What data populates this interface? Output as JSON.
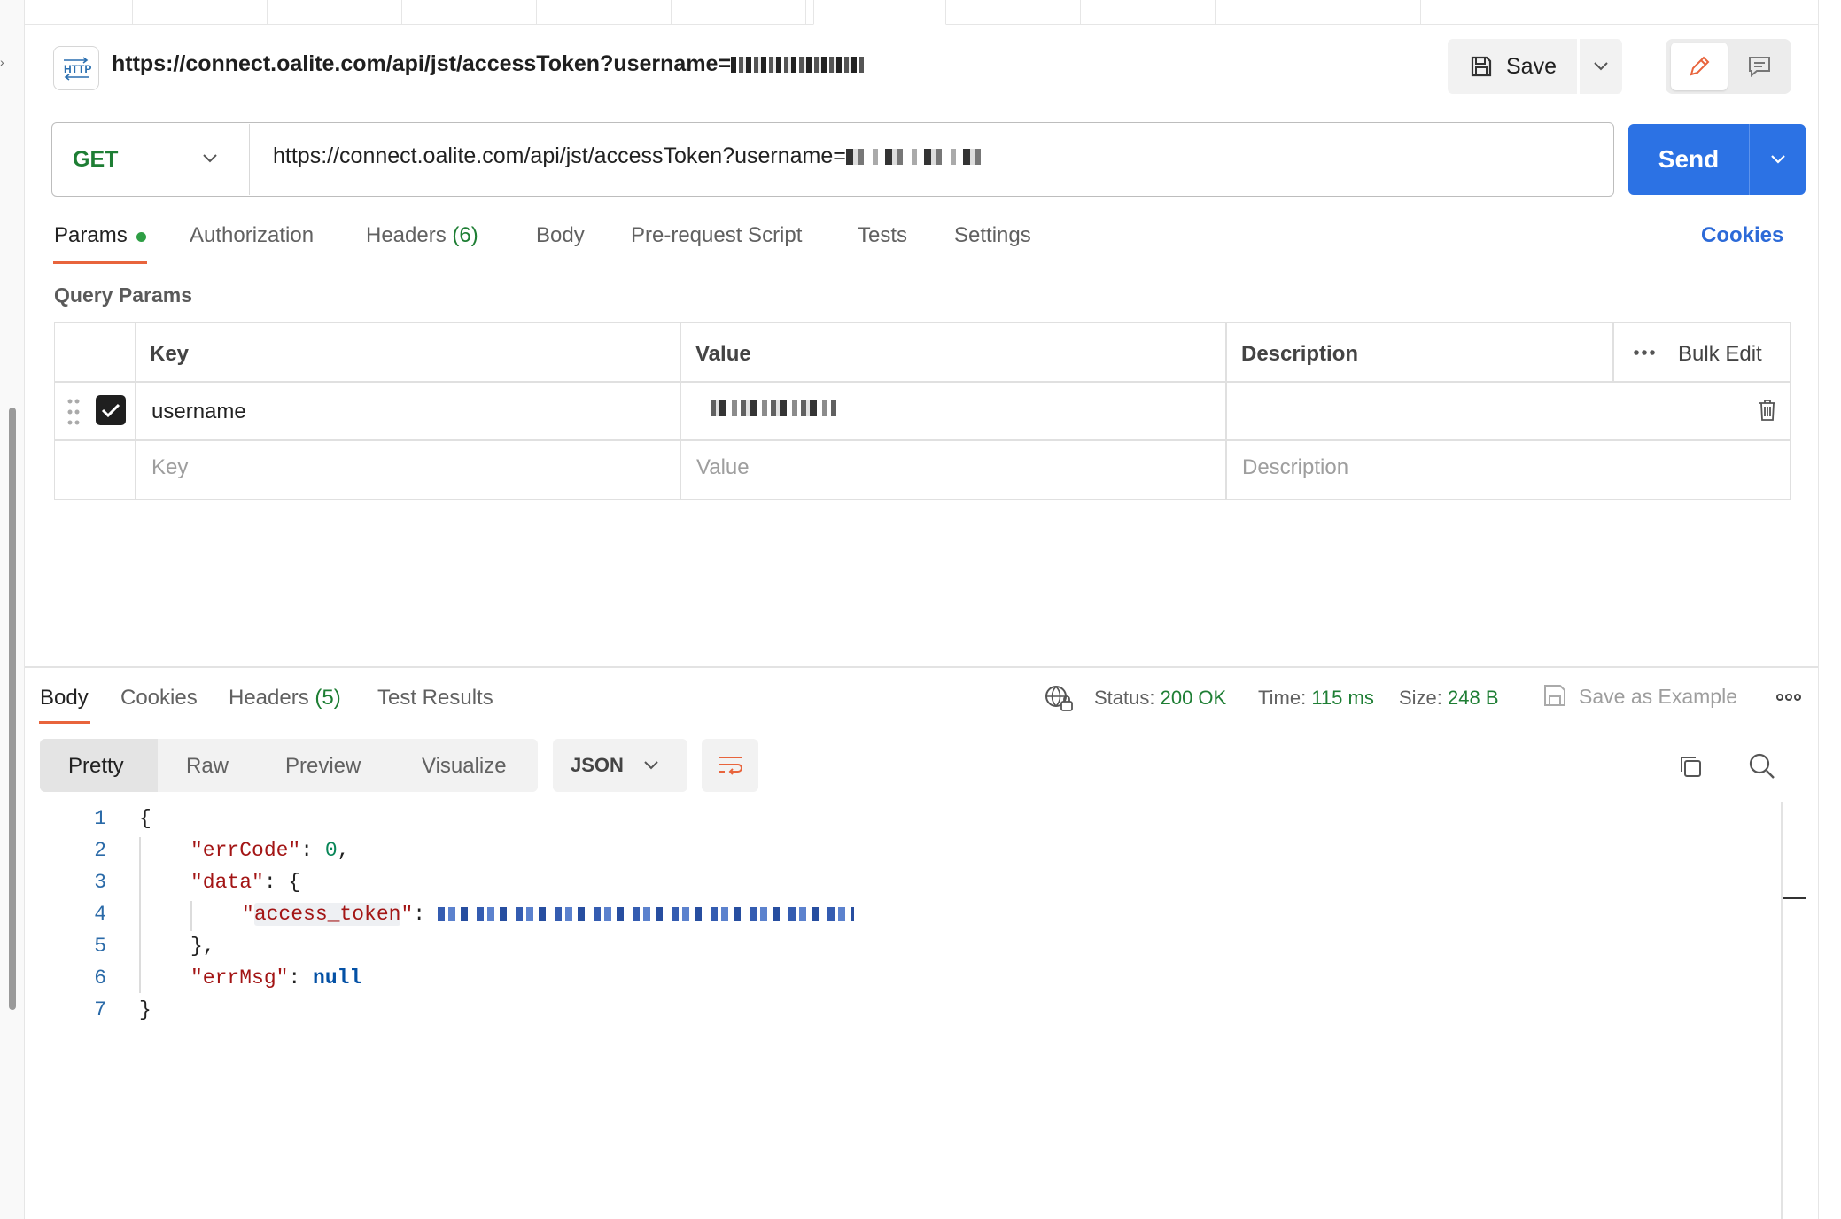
{
  "request": {
    "title": "https://connect.oalite.com/api/jst/accessToken?username=",
    "method": "GET",
    "url": "https://connect.oalite.com/api/jst/accessToken?username=",
    "save_label": "Save",
    "send_label": "Send"
  },
  "request_tabs": {
    "params": "Params",
    "authorization": "Authorization",
    "headers": "Headers",
    "headers_count": "(6)",
    "body": "Body",
    "prerequest": "Pre-request Script",
    "tests": "Tests",
    "settings": "Settings",
    "cookies": "Cookies"
  },
  "query_params": {
    "title": "Query Params",
    "columns": {
      "key": "Key",
      "value": "Value",
      "description": "Description"
    },
    "bulk_edit": "Bulk Edit",
    "rows": [
      {
        "key": "username",
        "value": "",
        "description": "",
        "enabled": true
      }
    ],
    "placeholders": {
      "key": "Key",
      "value": "Value",
      "description": "Description"
    }
  },
  "response_tabs": {
    "body": "Body",
    "cookies": "Cookies",
    "headers": "Headers",
    "headers_count": "(5)",
    "test_results": "Test Results"
  },
  "response_status": {
    "status_label": "Status:",
    "status_value": "200 OK",
    "time_label": "Time:",
    "time_value": "115 ms",
    "size_label": "Size:",
    "size_value": "248 B",
    "save_example": "Save as Example"
  },
  "format_toolbar": {
    "pretty": "Pretty",
    "raw": "Raw",
    "preview": "Preview",
    "visualize": "Visualize",
    "language": "JSON"
  },
  "response_body": {
    "line_numbers": [
      "1",
      "2",
      "3",
      "4",
      "5",
      "6",
      "7"
    ],
    "open_brace": "{",
    "close_brace": "}",
    "errcode_key": "\"errCode\"",
    "errcode_value": "0",
    "data_key": "\"data\"",
    "access_token_key": "\"access_token\"",
    "errmsg_key": "\"errMsg\"",
    "errmsg_value": "null"
  },
  "colors": {
    "accent_orange": "#e8643c",
    "send_blue": "#2c72e4",
    "status_green": "#1e7e34",
    "json_key": "#a31515",
    "json_number": "#098658",
    "json_keyword": "#0451a5"
  }
}
